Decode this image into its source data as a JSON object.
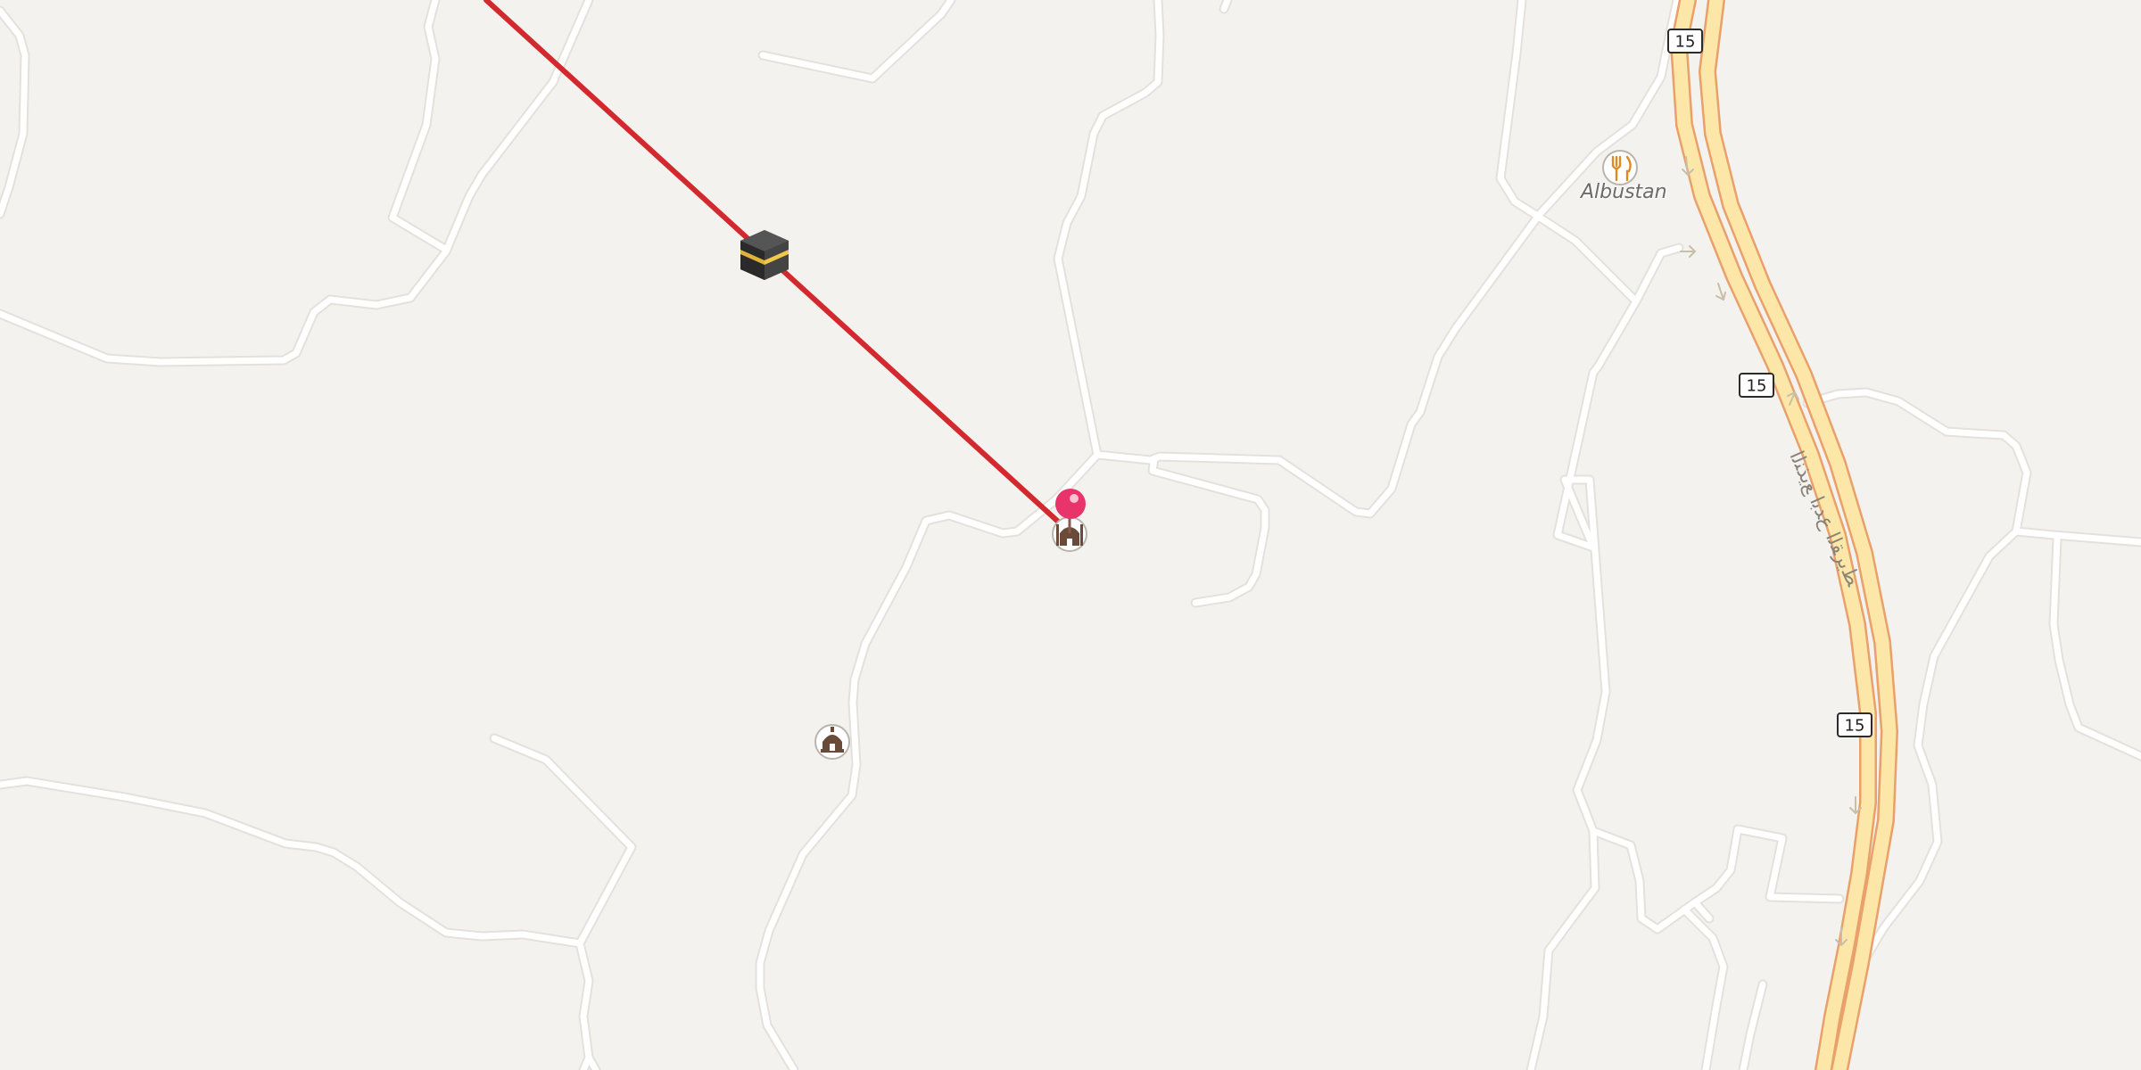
{
  "map": {
    "highway_shields": [
      {
        "id": "shield-top",
        "text": "15"
      },
      {
        "id": "shield-mid",
        "text": "15"
      },
      {
        "id": "shield-low",
        "text": "15"
      }
    ],
    "places": [
      {
        "id": "albustan",
        "name": "Albustan",
        "icon": "restaurant-icon"
      }
    ],
    "street_name": "ﻂﻳﺮﻘﻟﺍ ﻉﺪﺑﺍ ﻊﻳﺬﻨﻟﺍ",
    "markers": {
      "qibla_start": "kaaba-icon",
      "location_pin": "location-pin-icon",
      "mosque_near_pin": "mosque-icon",
      "mosque_south": "mosque-icon"
    },
    "colors": {
      "background": "#f4f2ef",
      "road": "#ffffff",
      "highway": "#fde7a8",
      "highway_outline": "#e9a06a",
      "qibla_line": "#d3292e",
      "pin": "#e8336b"
    }
  }
}
